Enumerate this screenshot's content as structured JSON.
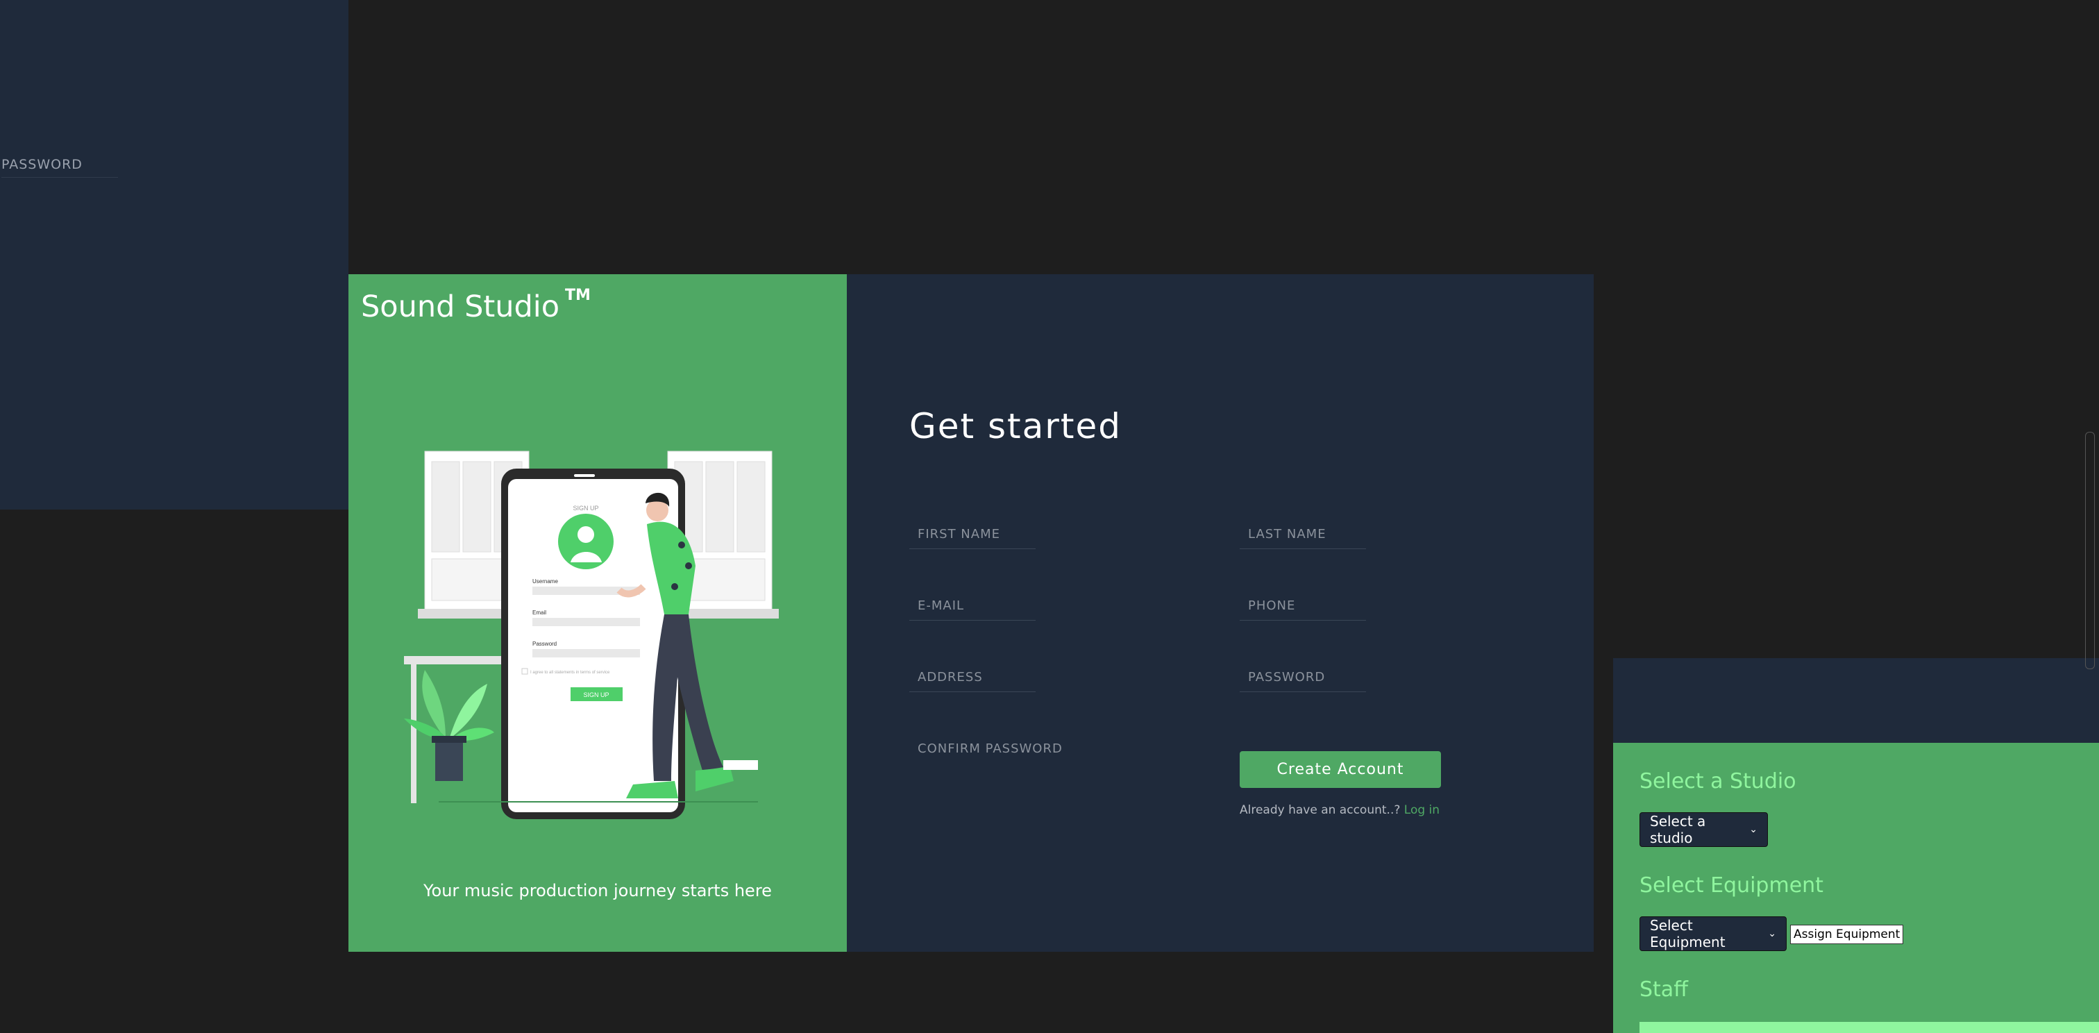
{
  "top_left_panel": {
    "password_label": "PASSWORD"
  },
  "left_panel": {
    "brand": "Sound Studio",
    "brand_mark": "TM",
    "tagline": "Your music production journey starts here",
    "illustration": {
      "header": "SIGN UP",
      "username_label": "Username",
      "email_label": "Email",
      "password_label": "Password",
      "terms": "I agree to all statements in terms of service",
      "button": "SIGN UP"
    }
  },
  "form": {
    "heading": "Get started",
    "fields": {
      "first_name": "FIRST NAME",
      "last_name": "LAST NAME",
      "email": "E-MAIL",
      "phone": "PHONE",
      "address": "ADDRESS",
      "password": "PASSWORD",
      "confirm_password": "CONFIRM PASSWORD"
    },
    "create_button": "Create Account",
    "already_text": "Already have an account..?",
    "login_link": "Log in"
  },
  "right_panel": {
    "studio_title": "Select a Studio",
    "studio_select": "Select a studio",
    "equipment_title": "Select Equipment",
    "equipment_select": "Select Equipment",
    "assign_button": "Assign Equipment",
    "staff_title": "Staff"
  },
  "colors": {
    "green": "#4fa864",
    "navy": "#1f2a3b",
    "background": "#1e1e1e",
    "accent_light_green": "#8ff59e"
  }
}
